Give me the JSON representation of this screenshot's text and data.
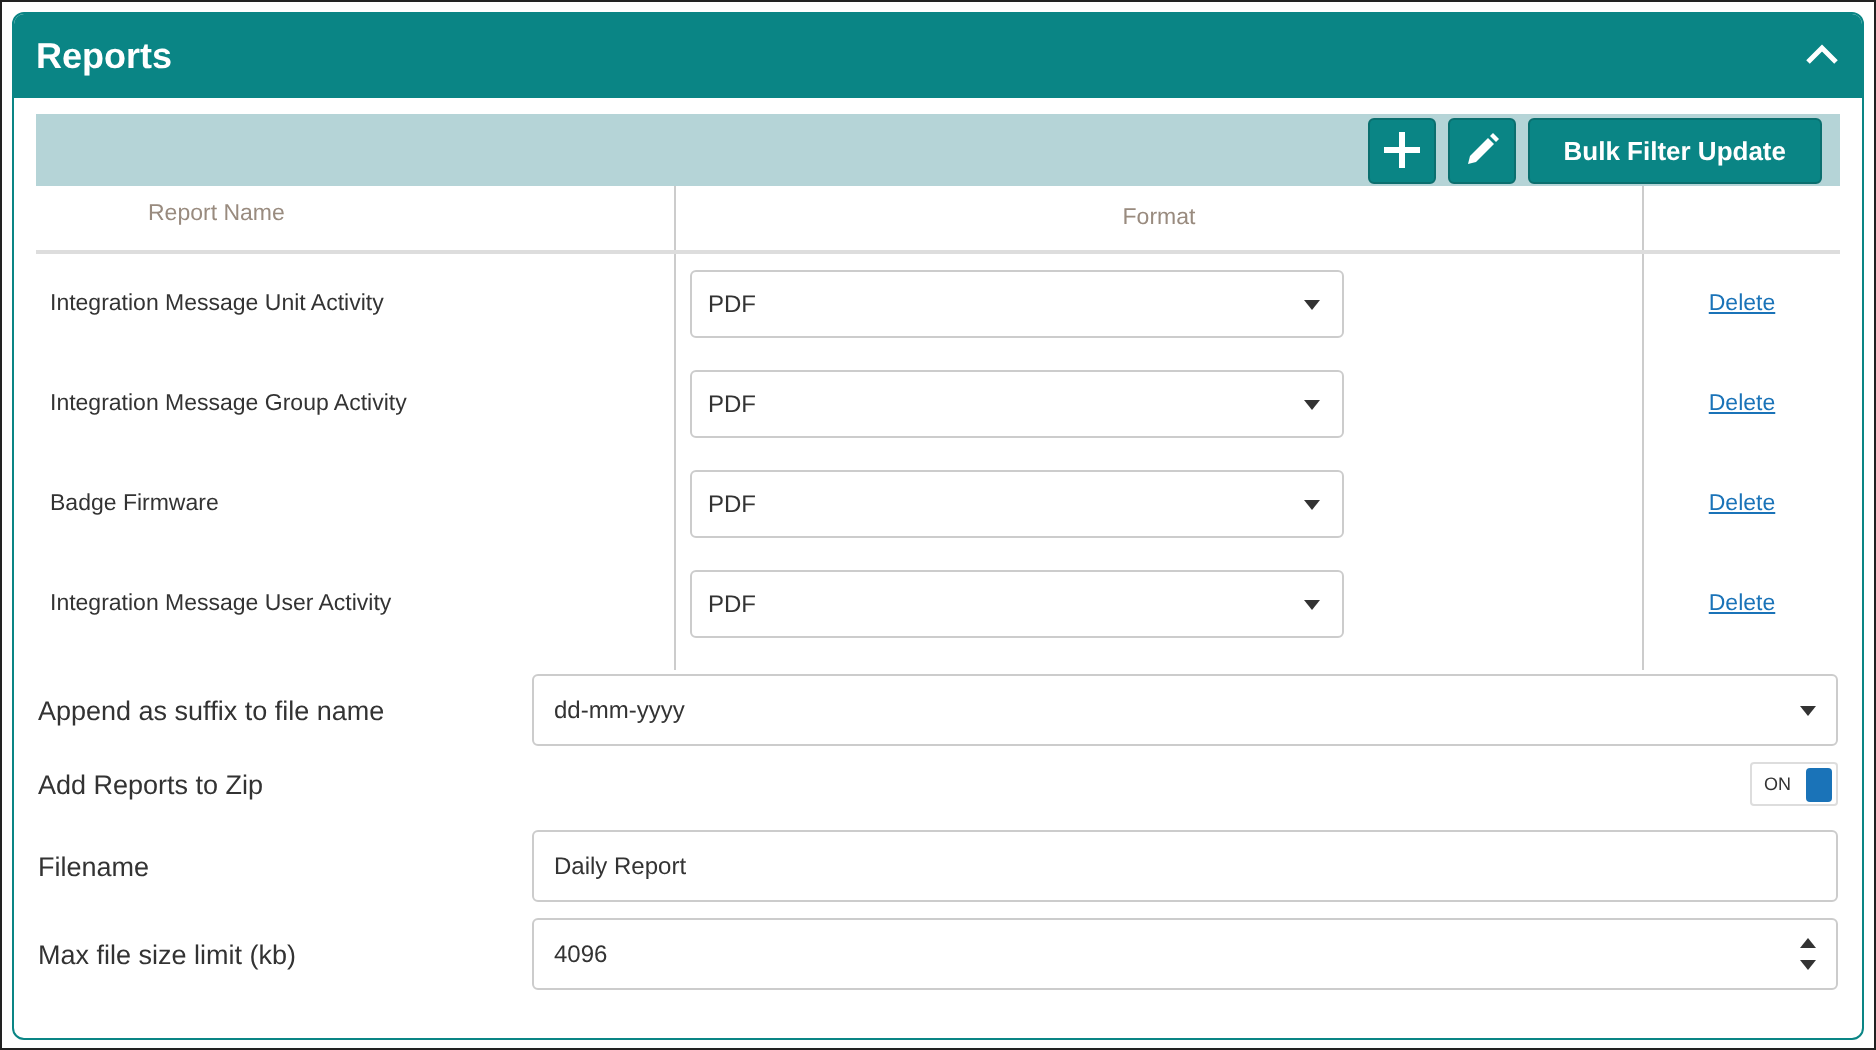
{
  "panel": {
    "title": "Reports",
    "expanded": true
  },
  "toolbar": [
    {
      "kind": "add"
    },
    {
      "kind": "edit"
    },
    {
      "kind": "text",
      "label": "Bulk Filter Update"
    }
  ],
  "table": {
    "columns": [
      "Report Name",
      "Format"
    ],
    "rows": [
      {
        "name": "Integration Message Unit Activity",
        "format": "PDF",
        "action": "Delete"
      },
      {
        "name": "Integration Message Group Activity",
        "format": "PDF",
        "action": "Delete"
      },
      {
        "name": "Badge Firmware",
        "format": "PDF",
        "action": "Delete"
      },
      {
        "name": "Integration Message User Activity",
        "format": "PDF",
        "action": "Delete"
      }
    ]
  },
  "settings": [
    {
      "kind": "select",
      "label": "Append as suffix to file name",
      "value": "dd-mm-yyyy"
    },
    {
      "kind": "toggle",
      "label": "Add Reports to Zip",
      "on": true,
      "text": "ON"
    },
    {
      "kind": "text",
      "label": "Filename",
      "value": "Daily Report"
    },
    {
      "kind": "number",
      "label": "Max file size limit (kb)",
      "value": "4096"
    }
  ]
}
